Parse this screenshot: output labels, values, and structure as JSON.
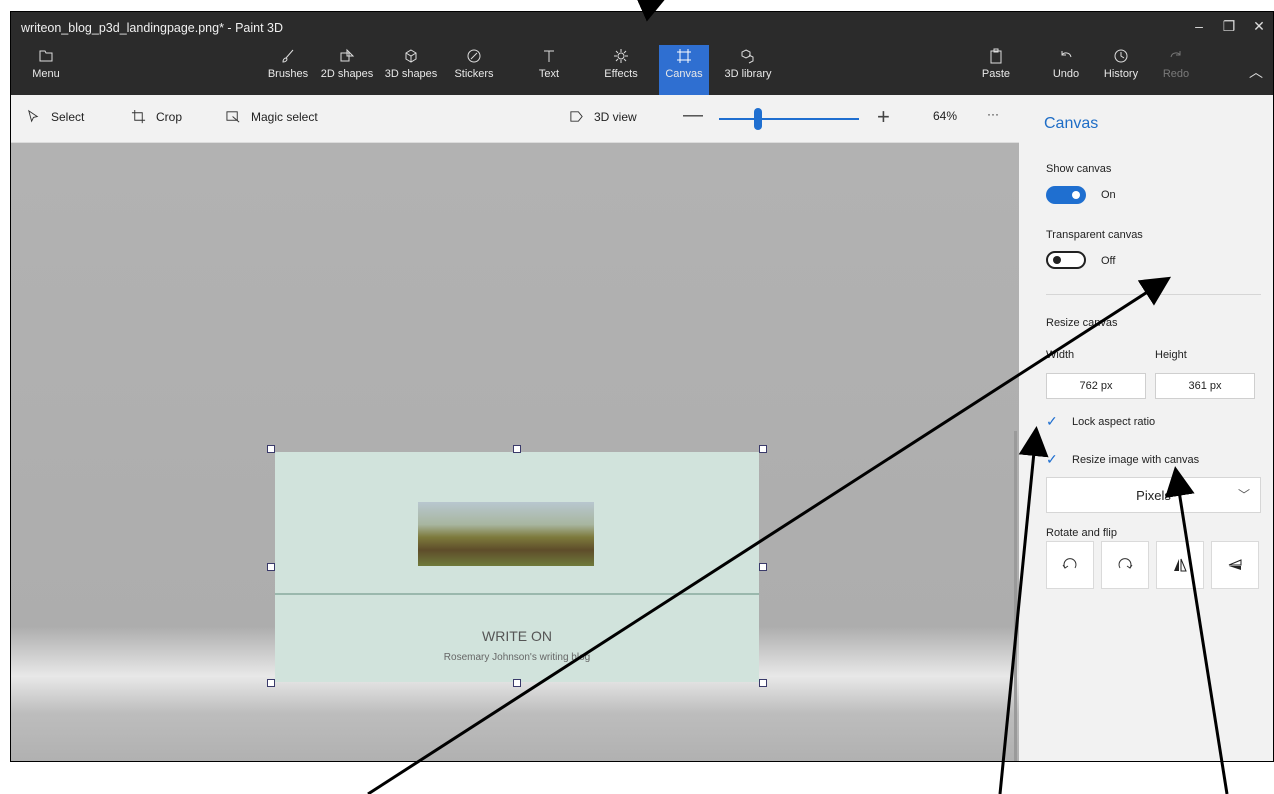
{
  "window": {
    "title": "writeon_blog_p3d_landingpage.png* - Paint 3D"
  },
  "ribbon": {
    "menu": "Menu",
    "tools": [
      "Brushes",
      "2D shapes",
      "3D shapes",
      "Stickers",
      "Text",
      "Effects",
      "Canvas",
      "3D library"
    ],
    "right": [
      "Paste",
      "Undo",
      "History",
      "Redo"
    ],
    "active_tool": "Canvas"
  },
  "subtoolbar": {
    "select": "Select",
    "crop": "Crop",
    "magic_select": "Magic select",
    "view_3d": "3D view",
    "zoom_level": "64%",
    "zoom_fraction": 0.28,
    "more": "···"
  },
  "document": {
    "title": "WRITE ON",
    "subtitle": "Rosemary Johnson's writing blog"
  },
  "panel": {
    "title": "Canvas",
    "show_canvas_label": "Show canvas",
    "show_canvas_state": "On",
    "transparent_label": "Transparent canvas",
    "transparent_state": "Off",
    "resize_label": "Resize canvas",
    "width_label": "Width",
    "height_label": "Height",
    "width_value": "762 px",
    "height_value": "361 px",
    "lock_aspect": "Lock aspect ratio",
    "resize_image": "Resize image with canvas",
    "units": "Pixels",
    "rotate_flip": "Rotate and flip"
  },
  "colors": {
    "accent": "#1f6fd0",
    "titlebar": "#2b2b2b",
    "active_tab": "#2f6fd1"
  }
}
